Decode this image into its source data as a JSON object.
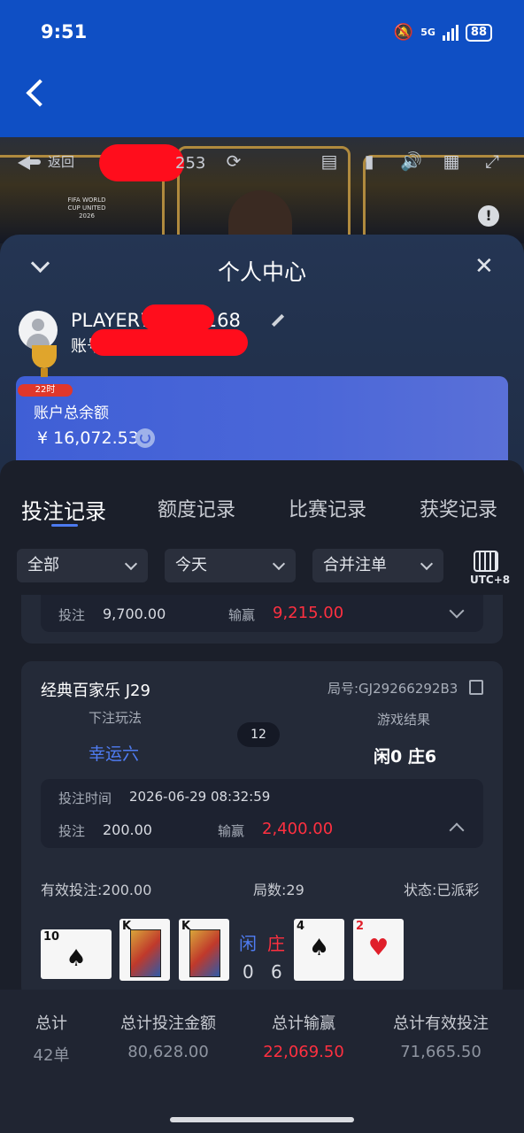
{
  "status_bar": {
    "time": "9:51",
    "network": "5G",
    "battery": "88"
  },
  "video": {
    "back_label": "返回",
    "table_code": "253",
    "fifa_text": "FIFA WORLD CUP UNITED 2026"
  },
  "sheet": {
    "title": "个人中心",
    "username": "PLAYER7...531168",
    "account_label": "账号",
    "vip_badge": "22时",
    "balance_label": "账户总余额",
    "balance_value": "¥ 16,072.53"
  },
  "tabs": [
    "投注记录",
    "额度记录",
    "比赛记录",
    "获奖记录"
  ],
  "filters": {
    "scope": "全部",
    "date": "今天",
    "merge": "合并注单",
    "timezone": "UTC+8"
  },
  "prev_card": {
    "bet_label": "投注",
    "bet_value": "9,700.00",
    "win_label": "输赢",
    "win_value": "9,215.00"
  },
  "record": {
    "game": "经典百家乐 J29",
    "round_id": "局号:GJ29266292B3",
    "play_label": "下注玩法",
    "play_value": "幸运六",
    "round_no": "12",
    "result_label": "游戏结果",
    "result_value": "闲0 庄6",
    "time_label": "投注时间",
    "time_value": "2026-06-29 08:32:59",
    "bet_label": "投注",
    "bet_value": "200.00",
    "win_label": "输赢",
    "win_value": "2,400.00",
    "valid_bet": "有效投注:200.00",
    "rounds": "局数:29",
    "status": "状态:已派彩",
    "player_label": "闲",
    "banker_label": "庄",
    "player_score": "0",
    "banker_score": "6",
    "cards": [
      {
        "rank": "10",
        "suit": "♠"
      },
      {
        "rank": "K",
        "suit": "♠"
      },
      {
        "rank": "K",
        "suit": "♠"
      },
      {
        "rank": "4",
        "suit": "♠"
      },
      {
        "rank": "2",
        "suit": "♥"
      }
    ]
  },
  "summary": {
    "headers": [
      "总计",
      "总计投注金额",
      "总计输赢",
      "总计有效投注"
    ],
    "values": [
      "42单",
      "80,628.00",
      "22,069.50",
      "71,665.50"
    ]
  },
  "colors": {
    "accent": "#4c7af0",
    "win_red": "#ff3040",
    "header_blue": "#0f4fc4"
  }
}
